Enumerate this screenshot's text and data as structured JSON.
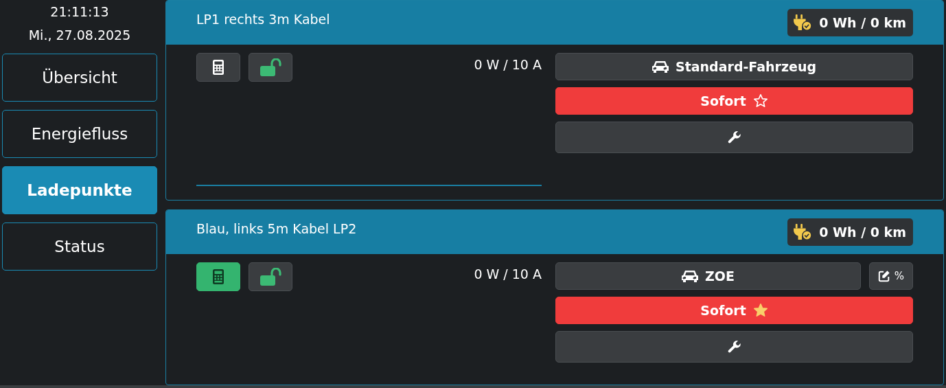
{
  "clock": {
    "time": "21:11:13",
    "date": "Mi., 27.08.2025"
  },
  "nav": [
    {
      "label": "Übersicht",
      "selected": false
    },
    {
      "label": "Energiefluss",
      "selected": false
    },
    {
      "label": "Ladepunkte",
      "selected": true
    },
    {
      "label": "Status",
      "selected": false
    }
  ],
  "charge_points": [
    {
      "title": "LP1 rechts 3m Kabel",
      "energy": "0 Wh / 0 km",
      "calculator_on": false,
      "power": "0 W / 10 A",
      "vehicle": "Standard-Fahrzeug",
      "mode": "Sofort",
      "priority": false,
      "progress_line": true
    },
    {
      "title": "Blau, links 5m Kabel LP2",
      "energy": "0 Wh / 0 km",
      "calculator_on": true,
      "power": "0 W / 10 A",
      "vehicle": "ZOE",
      "soc_button": "%",
      "mode": "Sofort",
      "priority": true
    }
  ]
}
